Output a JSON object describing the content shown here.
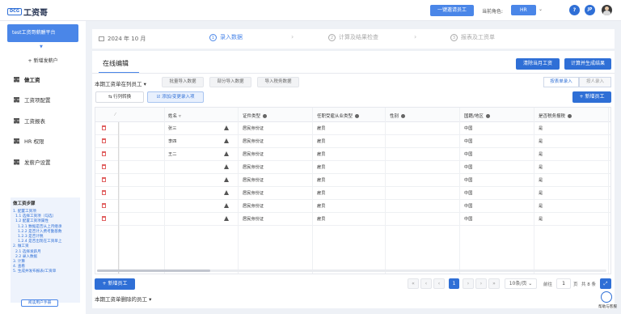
{
  "topbar": {
    "logo_mark": "DCG",
    "logo_text": "工资哥",
    "invite_button": "一键邀请员工",
    "role_label": "当前角色:",
    "role_value": "HR",
    "help": "?",
    "user_initials": "JP"
  },
  "sidebar": {
    "platform": "test工资哥薪酬平台",
    "add_payer": "+ 新增发薪户",
    "items": [
      {
        "label": "做工资",
        "icon": "grid-icon"
      },
      {
        "label": "工资项配置",
        "icon": "grid-icon"
      },
      {
        "label": "工资报表",
        "icon": "grid-icon"
      },
      {
        "label": "HR 权限",
        "icon": "grid-icon"
      },
      {
        "label": "发薪户设置",
        "icon": "grid-icon"
      }
    ],
    "steps_title": "做工资步骤",
    "steps": [
      "1. 配置工资项",
      "  1.1 选择工资项（勾选）",
      "  1.2 配置工资项属性",
      "    1.2.1 数据是否从上月继承",
      "    1.2.2 是否计入费考勤基数",
      "    1.2.3 是否计税",
      "    1.2.4 是否出现在工资单上",
      "2. 做工资",
      "  2.1 选择发薪月",
      "  2.2 录入数据",
      "3. 计算",
      "4. 查看",
      "5. 生成并发布报表/工资单"
    ],
    "manual_button": "阅读用户手册"
  },
  "stepbar": {
    "period": "2024 年 10 月",
    "steps": [
      {
        "num": "1",
        "label": "录入数据"
      },
      {
        "num": "2",
        "label": "计算及结果检查"
      },
      {
        "num": "3",
        "label": "报表及工资单"
      }
    ]
  },
  "main": {
    "tab": "在线编辑",
    "clear_button": "清除当月工资",
    "calc_button": "计算并生成结果",
    "current_label": "本期工资单在列员工",
    "import_buttons": [
      "批量导入数据",
      "部分导入数据",
      "导入税务数据"
    ],
    "table_entry": "按表单录入",
    "batch_entry": "按人录入",
    "rowcol_button": "行列转换",
    "add_change_button": "添加/变更录入项",
    "add_employee_button": "+ 新增员工",
    "headers": [
      "姓名",
      "证件类型",
      "任职受雇从业类型",
      "性别",
      "国籍/地区",
      "是否税务报税"
    ],
    "rows": [
      {
        "name": "张三",
        "id_type": "居民身份证",
        "employ": "雇员",
        "gender": "",
        "nation": "中国",
        "tax": "是"
      },
      {
        "name": "李四",
        "id_type": "居民身份证",
        "employ": "雇员",
        "gender": "",
        "nation": "中国",
        "tax": "是"
      },
      {
        "name": "王二",
        "id_type": "居民身份证",
        "employ": "雇员",
        "gender": "",
        "nation": "中国",
        "tax": "是"
      },
      {
        "name": "",
        "id_type": "居民身份证",
        "employ": "雇员",
        "gender": "",
        "nation": "中国",
        "tax": "是"
      },
      {
        "name": "",
        "id_type": "居民身份证",
        "employ": "雇员",
        "gender": "",
        "nation": "中国",
        "tax": "是"
      },
      {
        "name": "",
        "id_type": "居民身份证",
        "employ": "雇员",
        "gender": "",
        "nation": "中国",
        "tax": "是"
      },
      {
        "name": "",
        "id_type": "居民身份证",
        "employ": "雇员",
        "gender": "",
        "nation": "中国",
        "tax": "是"
      },
      {
        "name": "",
        "id_type": "居民身份证",
        "employ": "雇员",
        "gender": "",
        "nation": "中国",
        "tax": "是"
      }
    ],
    "add_employee_bottom": "+ 新增员工",
    "pager": {
      "current_page": "1",
      "page_size": "10条/页",
      "goto_label": "前往",
      "goto_value": "1",
      "page_unit": "页",
      "total": "共 8 条"
    },
    "deleted_label": "本期工资单删除的员工"
  },
  "chat": {
    "label": "帮助与客服"
  }
}
